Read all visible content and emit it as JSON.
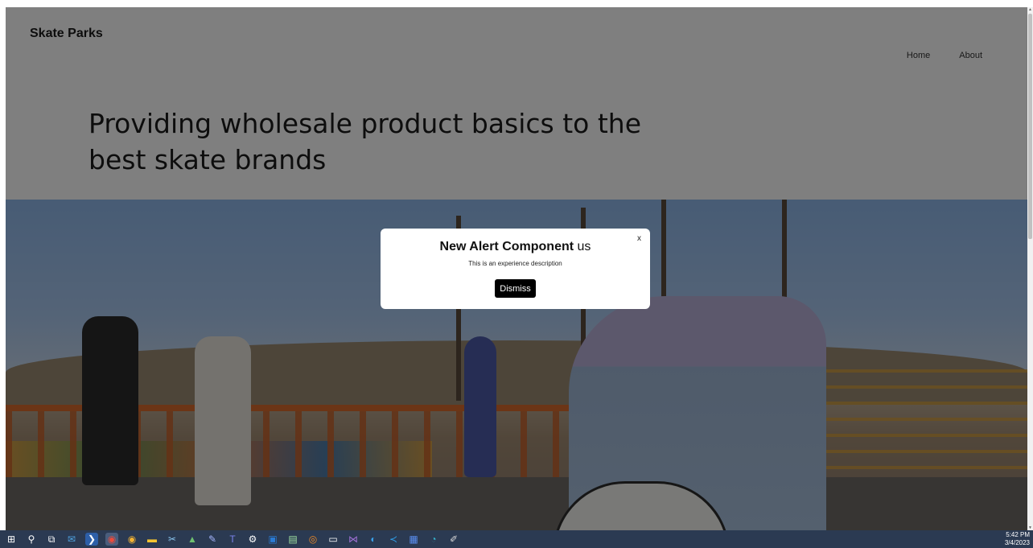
{
  "site": {
    "brand": "Skate Parks",
    "nav": [
      "Home",
      "About"
    ],
    "headline": "Providing wholesale product basics to the best skate brands"
  },
  "modal": {
    "title": "New Alert Component",
    "title_suffix": "us",
    "description": "This is an experience description",
    "close_label": "x",
    "dismiss_label": "Dismiss"
  },
  "taskbar": {
    "icons": [
      "windows-start-icon",
      "search-icon",
      "task-view-icon",
      "mail-icon",
      "powershell-icon",
      "chrome-icon",
      "chrome-canary-icon",
      "file-explorer-icon",
      "snip-icon",
      "photos-icon",
      "notes-icon",
      "teams-icon",
      "settings-icon",
      "outlook-icon",
      "notepad-icon",
      "app-icon",
      "terminal-icon",
      "visual-studio-icon",
      "edge-dev-icon",
      "vscode-icon",
      "calendar-icon",
      "edge-icon",
      "paint-icon"
    ],
    "time": "5:42 PM",
    "date": "3/4/2023"
  },
  "colors": {
    "overlay": "rgba(0,0,0,0.5)",
    "taskbar": "#2b3a52",
    "button": "#000000"
  }
}
